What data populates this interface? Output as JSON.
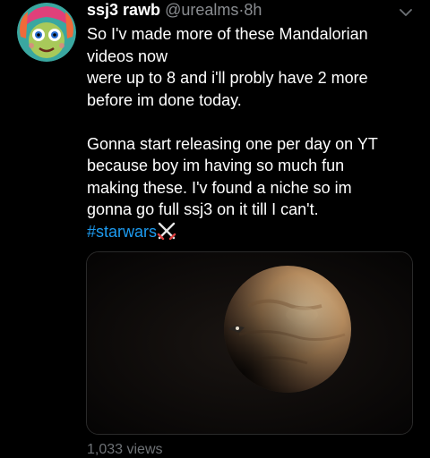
{
  "tweet": {
    "display_name": "ssj3 rawb",
    "handle": "@urealms",
    "separator": "·",
    "time": "8h",
    "lines": [
      "So I'v made more of these Mandalorian",
      "videos now",
      "were up to 8 and i'll probly have 2 more",
      "before im done today.",
      "",
      "Gonna start releasing one per day on YT",
      "because boy im having so much fun",
      "making these. I'v found a niche so im",
      "gonna go full ssj3 on it till I can't."
    ],
    "hashtag": "#starwars",
    "emoji": "crossed-swords-icon",
    "views": "1,033 views"
  },
  "colors": {
    "background": "#000000",
    "text": "#ffffff",
    "secondary": "#8a8d91",
    "link": "#1d9bf0"
  }
}
